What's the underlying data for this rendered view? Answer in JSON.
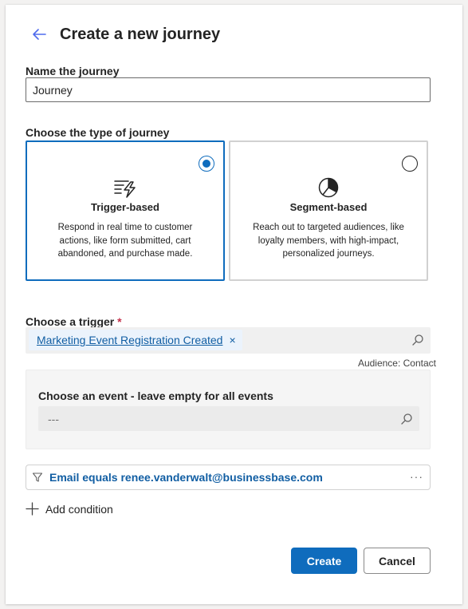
{
  "header": {
    "title": "Create a new journey",
    "back_icon": "arrow-left-icon"
  },
  "name_section": {
    "label": "Name the journey",
    "value": "Journey"
  },
  "type_section": {
    "label": "Choose the type of journey",
    "options": [
      {
        "title": "Trigger-based",
        "description": "Respond in real time to customer actions, like form submitted, cart abandoned, and purchase made.",
        "icon": "trigger-flash-icon",
        "selected": true
      },
      {
        "title": "Segment-based",
        "description": "Reach out to targeted audiences, like loyalty members, with high-impact, personalized journeys.",
        "icon": "pie-chart-icon",
        "selected": false
      }
    ]
  },
  "trigger_section": {
    "label": "Choose a trigger",
    "required_mark": "*",
    "selected_trigger": "Marketing Event Registration Created",
    "remove_symbol": "×",
    "audience": "Audience: Contact"
  },
  "event_section": {
    "label": "Choose an event - leave empty for all events",
    "placeholder": "---"
  },
  "condition": {
    "text": "Email equals renee.vanderwalt@businessbase.com",
    "more": "···"
  },
  "add_condition": {
    "label": "Add condition"
  },
  "buttons": {
    "create": "Create",
    "cancel": "Cancel"
  },
  "colors": {
    "accent": "#0f6cbd",
    "link": "#115ea3"
  }
}
